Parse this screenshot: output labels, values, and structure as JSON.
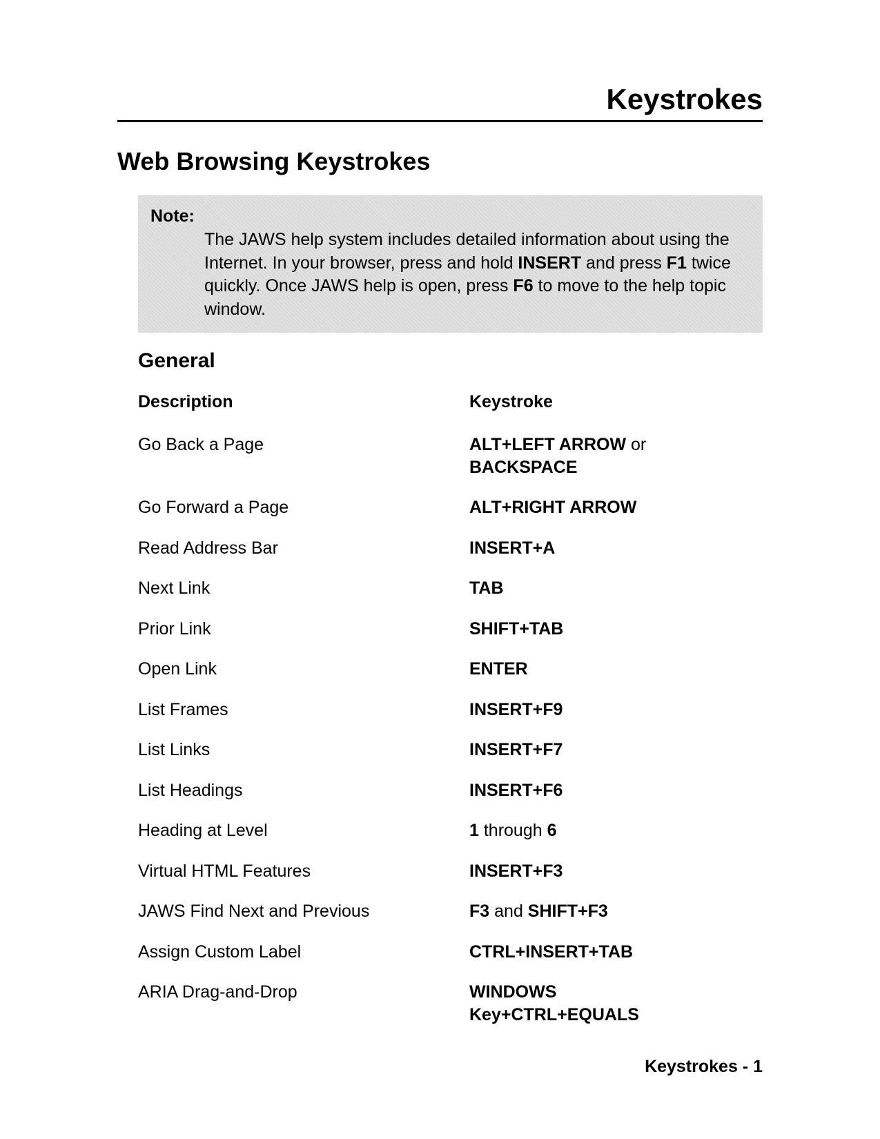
{
  "top_title": "Keystrokes",
  "section_title": "Web Browsing Keystrokes",
  "note": {
    "label": "Note:",
    "segments": [
      {
        "t": "  The JAWS help system includes detailed information about using the Internet. In your browser, press and hold "
      },
      {
        "t": "INSERT",
        "b": true
      },
      {
        "t": " and press "
      },
      {
        "t": "F1",
        "b": true
      },
      {
        "t": " twice quickly. Once JAWS help is open, press "
      },
      {
        "t": "F6",
        "b": true
      },
      {
        "t": " to move to the help topic window."
      }
    ]
  },
  "sub_heading": "General",
  "table": {
    "header": {
      "desc": "Description",
      "key": "Keystroke"
    },
    "rows": [
      {
        "desc": "Go Back a Page",
        "key": [
          {
            "t": "ALT+LEFT ARROW",
            "b": true
          },
          {
            "t": " or "
          },
          {
            "t": "BACKSPACE",
            "b": true
          }
        ]
      },
      {
        "desc": "Go Forward a Page",
        "key": [
          {
            "t": "ALT+RIGHT ARROW",
            "b": true
          }
        ]
      },
      {
        "desc": "Read Address Bar",
        "key": [
          {
            "t": "INSERT+A",
            "b": true
          }
        ]
      },
      {
        "desc": "Next Link",
        "key": [
          {
            "t": "TAB",
            "b": true
          }
        ]
      },
      {
        "desc": "Prior Link",
        "key": [
          {
            "t": "SHIFT+TAB",
            "b": true
          }
        ]
      },
      {
        "desc": "Open Link",
        "key": [
          {
            "t": "ENTER",
            "b": true
          }
        ]
      },
      {
        "desc": "List Frames",
        "key": [
          {
            "t": "INSERT+F9",
            "b": true
          }
        ]
      },
      {
        "desc": "List Links",
        "key": [
          {
            "t": "INSERT+F7",
            "b": true
          }
        ]
      },
      {
        "desc": "List Headings",
        "key": [
          {
            "t": "INSERT+F6",
            "b": true
          }
        ]
      },
      {
        "desc": "Heading at Level",
        "key": [
          {
            "t": "1",
            "b": true
          },
          {
            "t": " through "
          },
          {
            "t": "6",
            "b": true
          }
        ]
      },
      {
        "desc": "Virtual HTML Features",
        "key": [
          {
            "t": "INSERT+F3",
            "b": true
          }
        ]
      },
      {
        "desc": "JAWS Find Next and Previous",
        "key": [
          {
            "t": "F3",
            "b": true
          },
          {
            "t": " and "
          },
          {
            "t": "SHIFT+F3",
            "b": true
          }
        ]
      },
      {
        "desc": "Assign Custom Label",
        "key": [
          {
            "t": "CTRL+INSERT+TAB",
            "b": true
          }
        ]
      },
      {
        "desc": "ARIA Drag-and-Drop",
        "key": [
          {
            "t": "WINDOWS Key+CTRL+EQUALS",
            "b": true
          }
        ]
      }
    ]
  },
  "footer": "Keystrokes - 1"
}
